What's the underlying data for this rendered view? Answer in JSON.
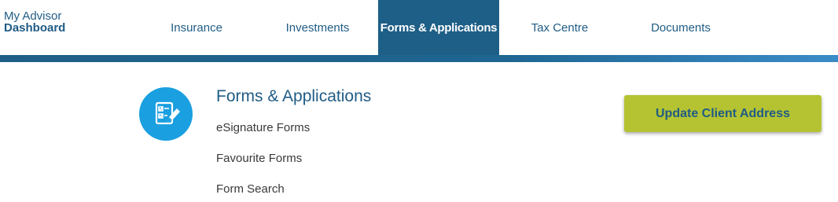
{
  "brand": {
    "line1": "My Advisor",
    "line2": "Dashboard"
  },
  "nav": {
    "items": [
      {
        "label": "Insurance"
      },
      {
        "label": "Investments"
      },
      {
        "label": "Forms & Applications",
        "active": true
      },
      {
        "label": "Tax Centre"
      },
      {
        "label": "Documents"
      }
    ]
  },
  "section": {
    "icon": "forms-checklist-icon",
    "title": "Forms & Applications",
    "links": [
      {
        "label": "eSignature Forms"
      },
      {
        "label": "Favourite Forms"
      },
      {
        "label": "Form Search"
      }
    ]
  },
  "action": {
    "label": "Update Client Address"
  },
  "colors": {
    "primary": "#1e5f87",
    "icon_circle": "#1a9fe0",
    "action_button": "#b5c332",
    "text": "#3a3a3a"
  }
}
